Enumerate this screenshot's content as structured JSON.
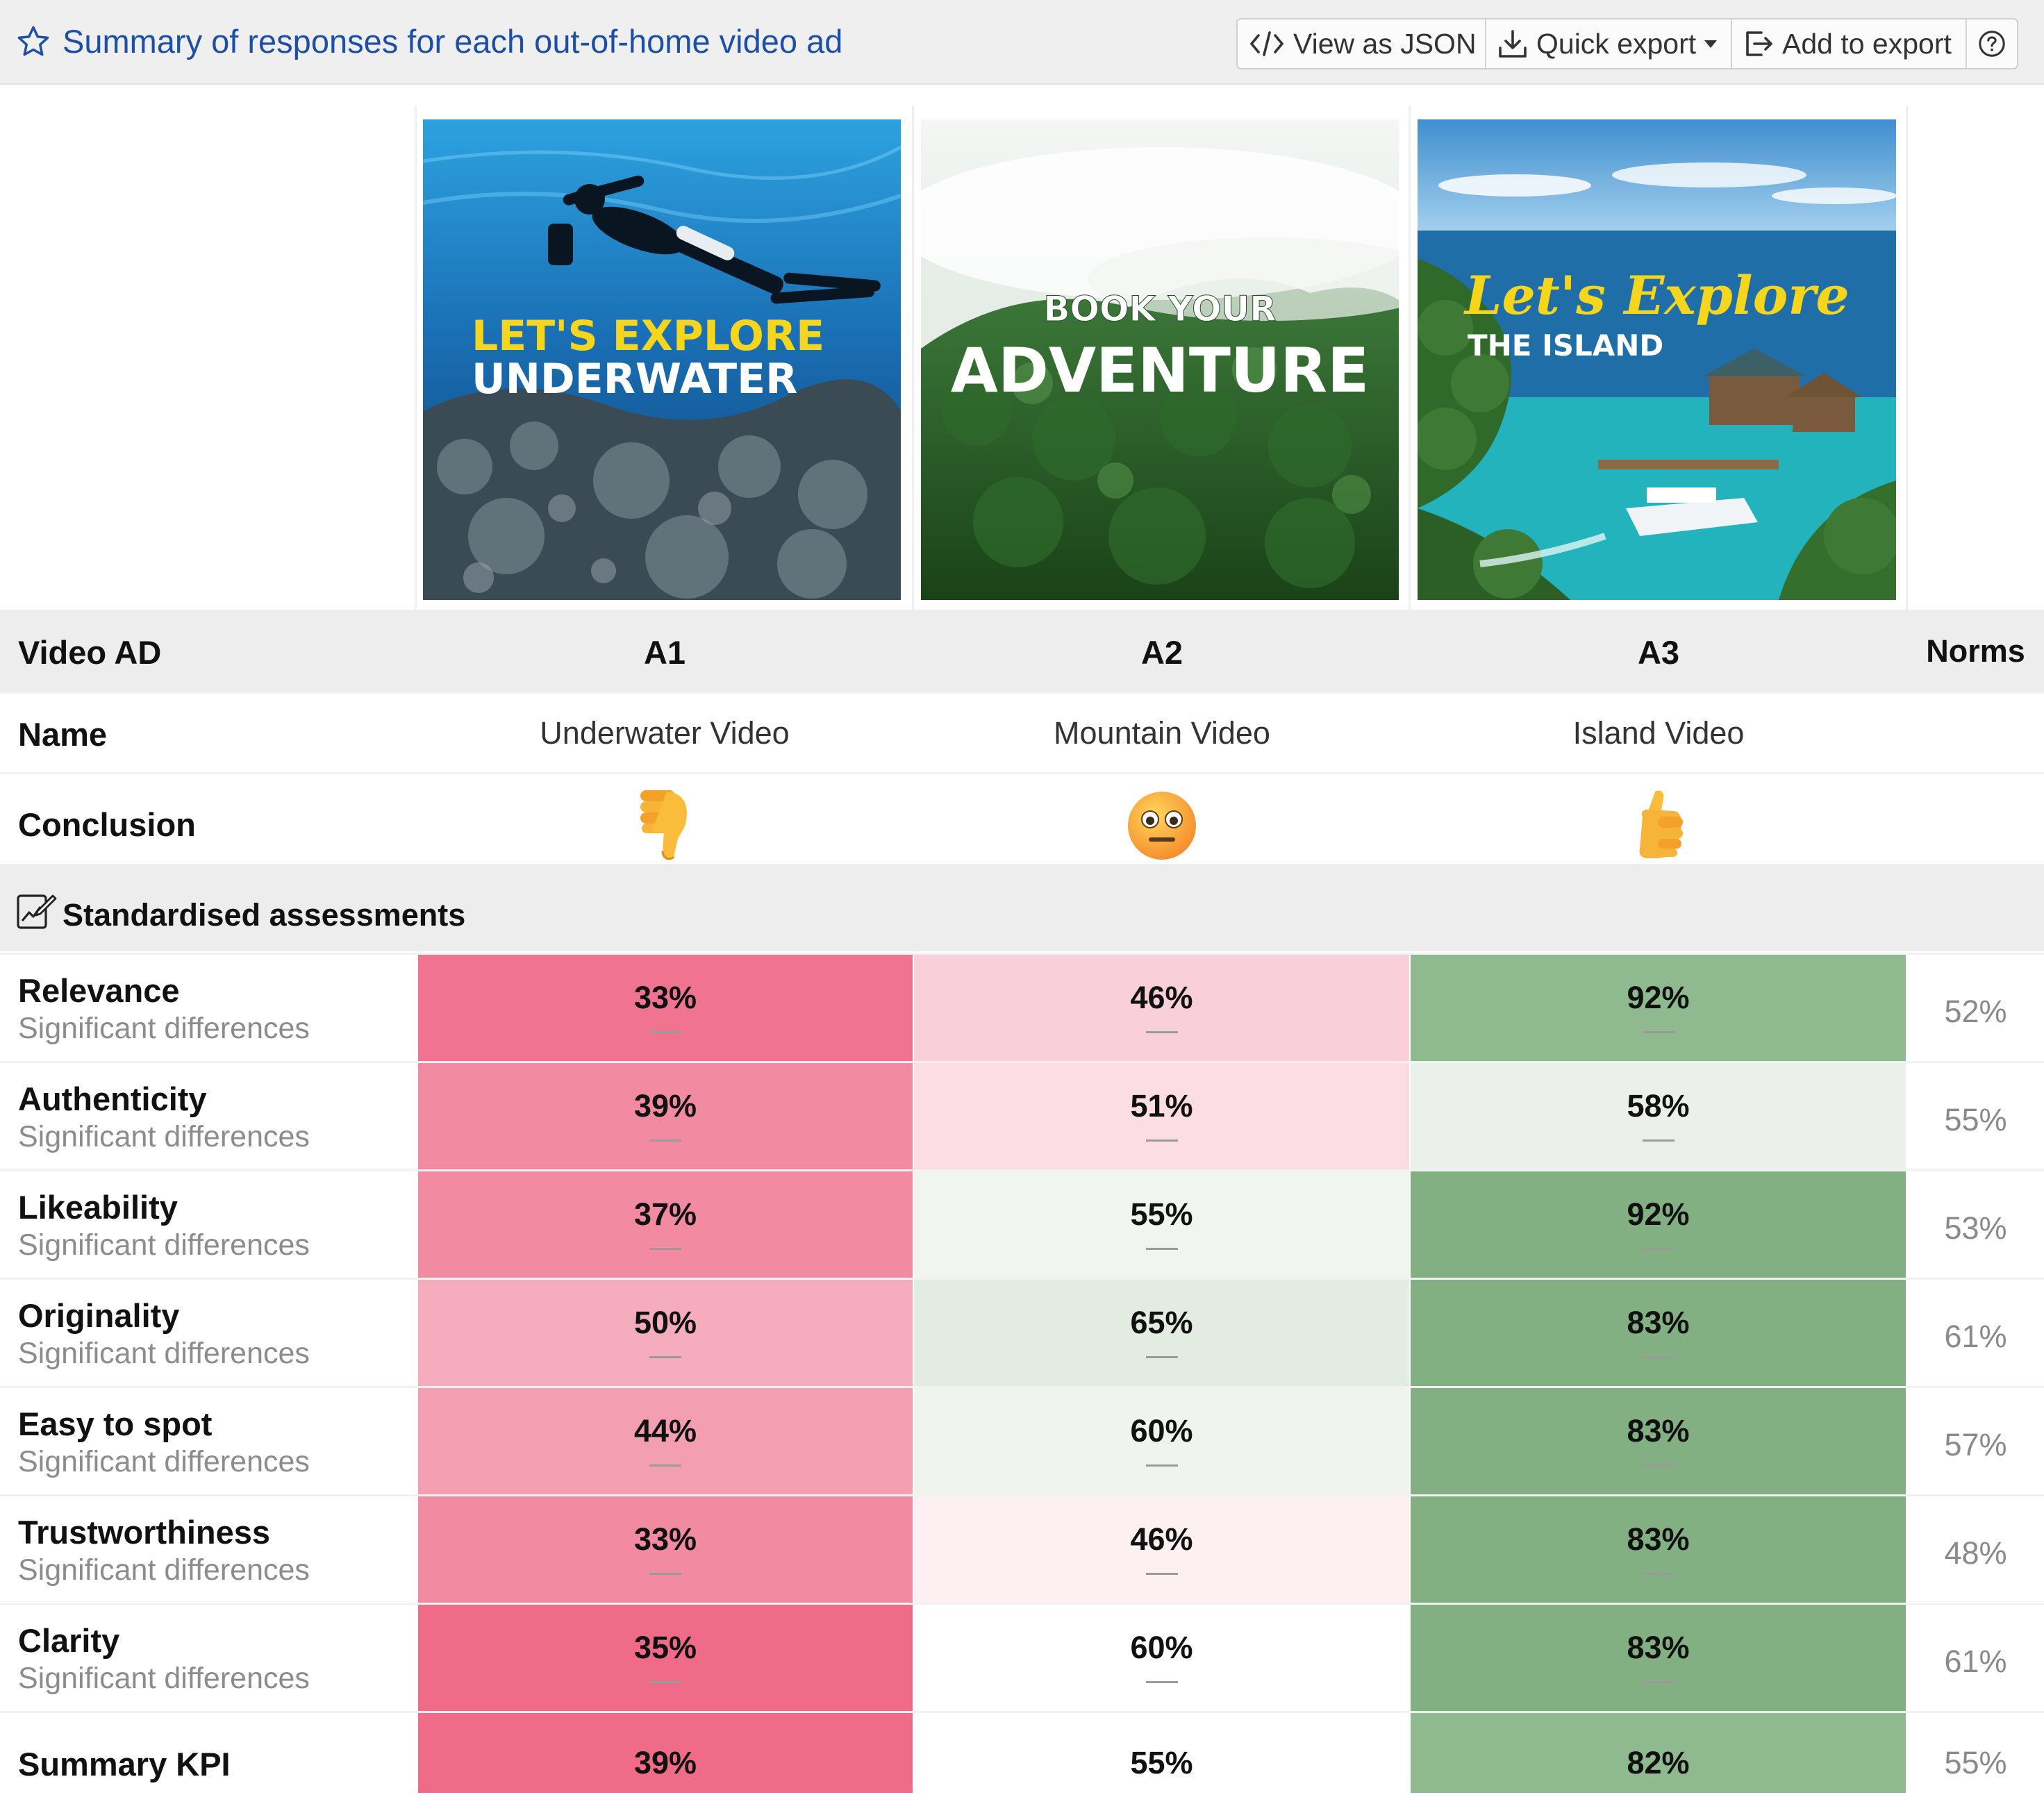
{
  "header": {
    "title": "Summary of responses for each out-of-home video ad",
    "buttons": {
      "view_json": "View as JSON",
      "quick_export": "Quick export",
      "add_export": "Add to export"
    },
    "icons": [
      "star-icon",
      "code-icon",
      "download-icon",
      "export-icon",
      "help-icon"
    ]
  },
  "ads": [
    {
      "id": "A1",
      "name": "Underwater Video",
      "conclusion_icon": "thumbs-down-icon",
      "thumbnail": {
        "line1": "LET'S EXPLORE",
        "line2": "UNDERWATER"
      }
    },
    {
      "id": "A2",
      "name": "Mountain Video",
      "conclusion_icon": "neutral-face-icon",
      "thumbnail": {
        "line1": "BOOK YOUR",
        "line2": "ADVENTURE"
      }
    },
    {
      "id": "A3",
      "name": "Island Video",
      "conclusion_icon": "thumbs-up-icon",
      "thumbnail": {
        "line1": "Let's Explore",
        "line2": "THE ISLAND"
      }
    }
  ],
  "labels": {
    "video_ad": "Video AD",
    "norms": "Norms",
    "name": "Name",
    "conclusion": "Conclusion",
    "section": "Standardised assessments",
    "sig_diff": "Significant differences"
  },
  "metrics": [
    {
      "label": "Relevance",
      "values": [
        "33%",
        "46%",
        "92%"
      ],
      "norm": "52%",
      "colors": [
        "#f0748f",
        "#f9d0da",
        "#8fb98e"
      ]
    },
    {
      "label": "Authenticity",
      "values": [
        "39%",
        "51%",
        "58%"
      ],
      "norm": "55%",
      "colors": [
        "#f28ba1",
        "#fbdde3",
        "#ebf1ea"
      ]
    },
    {
      "label": "Likeability",
      "values": [
        "37%",
        "55%",
        "92%"
      ],
      "norm": "53%",
      "colors": [
        "#f28ba1",
        "#f0f5ef",
        "#83b083"
      ]
    },
    {
      "label": "Originality",
      "values": [
        "50%",
        "65%",
        "83%"
      ],
      "norm": "61%",
      "colors": [
        "#f5adbd",
        "#e2ece0",
        "#83b083"
      ]
    },
    {
      "label": "Easy to spot",
      "values": [
        "44%",
        "60%",
        "83%"
      ],
      "norm": "57%",
      "colors": [
        "#f49fb1",
        "#eff4ee",
        "#83b083"
      ]
    },
    {
      "label": "Trustworthiness",
      "values": [
        "33%",
        "46%",
        "83%"
      ],
      "norm": "48%",
      "colors": [
        "#f28ba1",
        "#fcf0f3",
        "#83b083"
      ]
    },
    {
      "label": "Clarity",
      "values": [
        "35%",
        "60%",
        "83%"
      ],
      "norm": "61%",
      "colors": [
        "#f06b87",
        "#ffffff",
        "#83b083"
      ]
    },
    {
      "label": "Summary KPI",
      "values": [
        "39%",
        "55%",
        "82%"
      ],
      "norm": "55%",
      "colors": [
        "#f06b87",
        "#ffffff",
        "#8fb98e"
      ]
    }
  ]
}
